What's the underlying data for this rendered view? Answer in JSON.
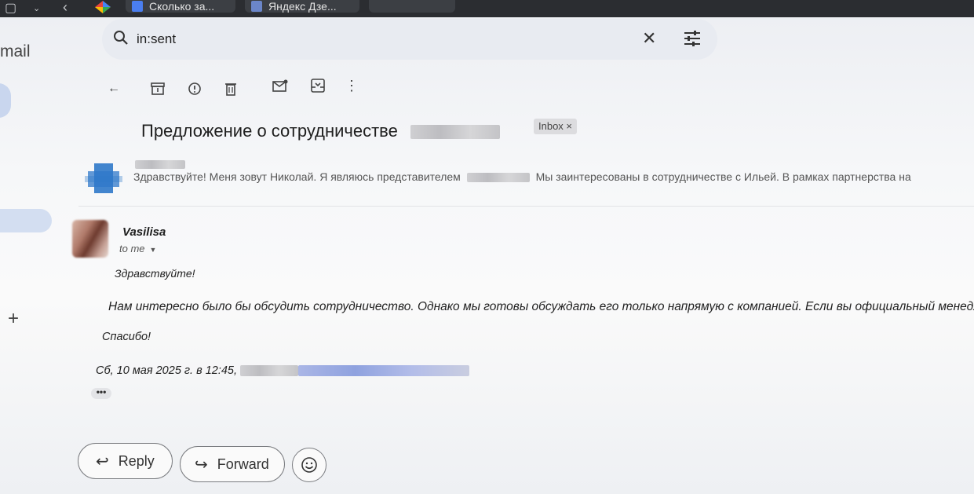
{
  "browser": {
    "tabs": [
      {
        "label": "Сколько за..."
      },
      {
        "label": "Яндекс Дзе..."
      }
    ]
  },
  "app": {
    "brand": "mail"
  },
  "search": {
    "query": "in:sent"
  },
  "thread": {
    "subject": "Предложение о сотрудничестве",
    "label_badge": "Inbox ×",
    "collapsed_message": {
      "snippet_start": "Здравствуйте! Меня зовут Николай. Я являюсь представителем",
      "snippet_end": "Мы заинтересованы в сотрудничестве с Ильей. В рамках партнерства на"
    },
    "open_message": {
      "sender": "Vasilisa",
      "recipient": "to me",
      "greeting": "Здравствуйте!",
      "paragraph": "Нам интересно было бы обсудить сотрудничество. Однако мы готовы обсуждать его только напрямую с компанией. Если вы официальный менедж",
      "closing": "Спасибо!",
      "quote_header": "Сб, 10 мая 2025 г. в 12:45,",
      "more_indicator": "•••"
    }
  },
  "actions": {
    "reply": "Reply",
    "forward": "Forward"
  },
  "colors": {
    "avatar_blue": "#2f78c9",
    "search_bg": "#e8ebf1",
    "nav_highlight": "#d3def1"
  }
}
